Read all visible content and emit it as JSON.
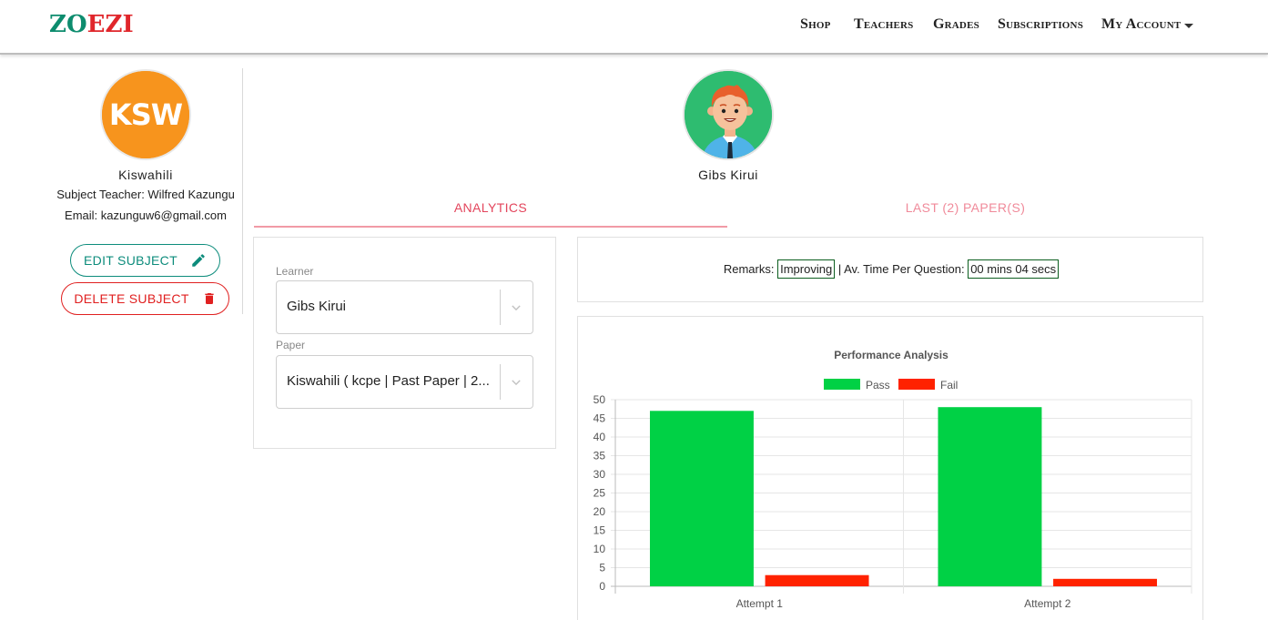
{
  "brand": {
    "logo_part1": "ZO",
    "logo_part2": "EZI"
  },
  "nav": {
    "items": [
      "Shop",
      "Teachers",
      "Grades",
      "Subscriptions",
      "My Account"
    ]
  },
  "subject": {
    "avatar_text": "KSW",
    "name": "Kiswahili",
    "teacher": "Subject Teacher: Wilfred Kazungu",
    "email": "Email: kazunguw6@gmail.com",
    "edit_label": "EDIT SUBJECT",
    "delete_label": "DELETE SUBJECT"
  },
  "learner": {
    "name": "Gibs Kirui"
  },
  "tabs": {
    "analytics": "ANALYTICS",
    "papers": "LAST (2) PAPER(S)"
  },
  "filters": {
    "learner_label": "Learner",
    "learner_value": "Gibs Kirui",
    "paper_label": "Paper",
    "paper_value": "Kiswahili ( kcpe | Past Paper | 2..."
  },
  "remarks": {
    "remarks_label": "Remarks:",
    "remarks_value": "Improving",
    "separator": "|",
    "time_label": "Av. Time Per Question:",
    "time_value": "00 mins 04 secs"
  },
  "colors": {
    "pass": "#00d145",
    "fail": "#ff2200",
    "accent": "#e3455c",
    "teal": "#0d8c7c"
  },
  "chart_data": {
    "type": "bar",
    "title": "Performance Analysis",
    "categories": [
      "Attempt 1",
      "Attempt 2"
    ],
    "series": [
      {
        "name": "Pass",
        "values": [
          47,
          48
        ]
      },
      {
        "name": "Fail",
        "values": [
          3,
          2
        ]
      }
    ],
    "ylim": [
      0,
      50
    ],
    "yticks": [
      0,
      5,
      10,
      15,
      20,
      25,
      30,
      35,
      40,
      45,
      50
    ],
    "legend": "top",
    "grid": true
  }
}
